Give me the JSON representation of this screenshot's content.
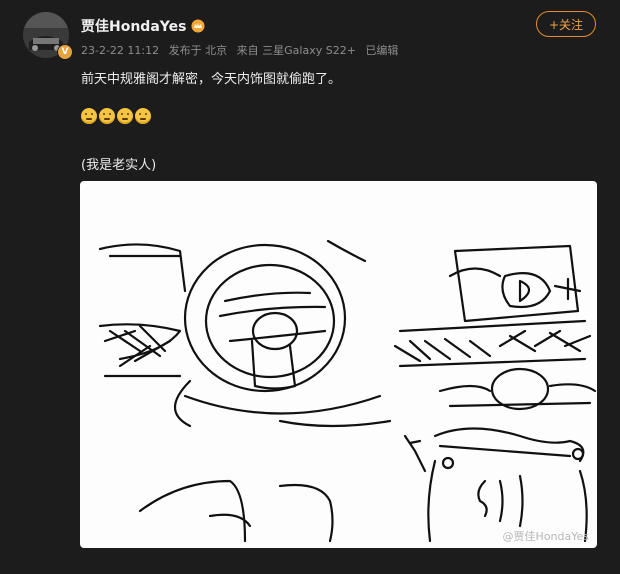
{
  "user": {
    "name": "贾佳HondaYes",
    "verified_badge": "V",
    "avatar_icon": "car-avatar"
  },
  "meta": {
    "date": "23-2-22 11:12",
    "location": "发布于 北京",
    "source": "来自 三星Galaxy S22+",
    "edited": "已编辑"
  },
  "follow_label": "+关注",
  "content": {
    "line1": "前天中规雅阁才解密，今天内饰图就偷跑了。",
    "emojis": [
      "doge-emoji",
      "doge-emoji",
      "doge-emoji",
      "doge-emoji"
    ],
    "line2": "(我是老实人)"
  },
  "image": {
    "watermark": "@贾佳HondaYes"
  },
  "colors": {
    "background": "#1c1c1c",
    "follow_accent": "#e38b2f"
  }
}
